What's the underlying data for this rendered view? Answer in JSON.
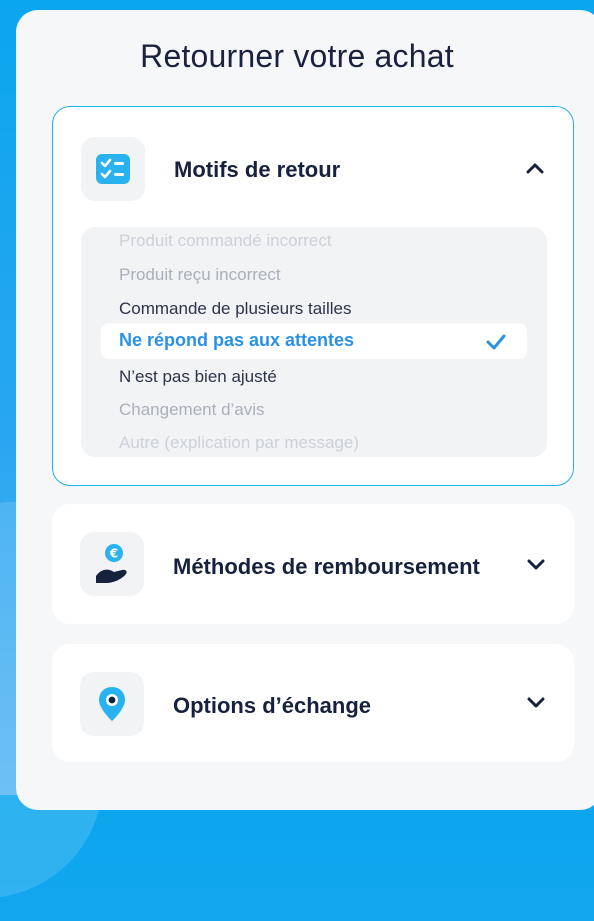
{
  "page": {
    "title": "Retourner votre achat"
  },
  "sections": [
    {
      "label": "Motifs de retour",
      "icon": "checklist-icon",
      "expanded": true,
      "reasons": [
        "Produit commandé incorrect",
        "Produit reçu incorrect",
        "Commande de plusieurs tailles",
        "Ne répond pas aux attentes",
        "N’est pas bien ajusté",
        "Changement d’avis",
        "Autre (explication par message)"
      ],
      "selected_reason": "Ne répond pas aux attentes"
    },
    {
      "label": "Méthodes de remboursement",
      "icon": "hand-euro-coin-icon",
      "expanded": false
    },
    {
      "label": "Options d’échange",
      "icon": "location-pin-icon",
      "expanded": false
    }
  ],
  "colors": {
    "accent": "#22b2ee",
    "selected_text": "#2a92e6",
    "heading": "#16213d"
  }
}
